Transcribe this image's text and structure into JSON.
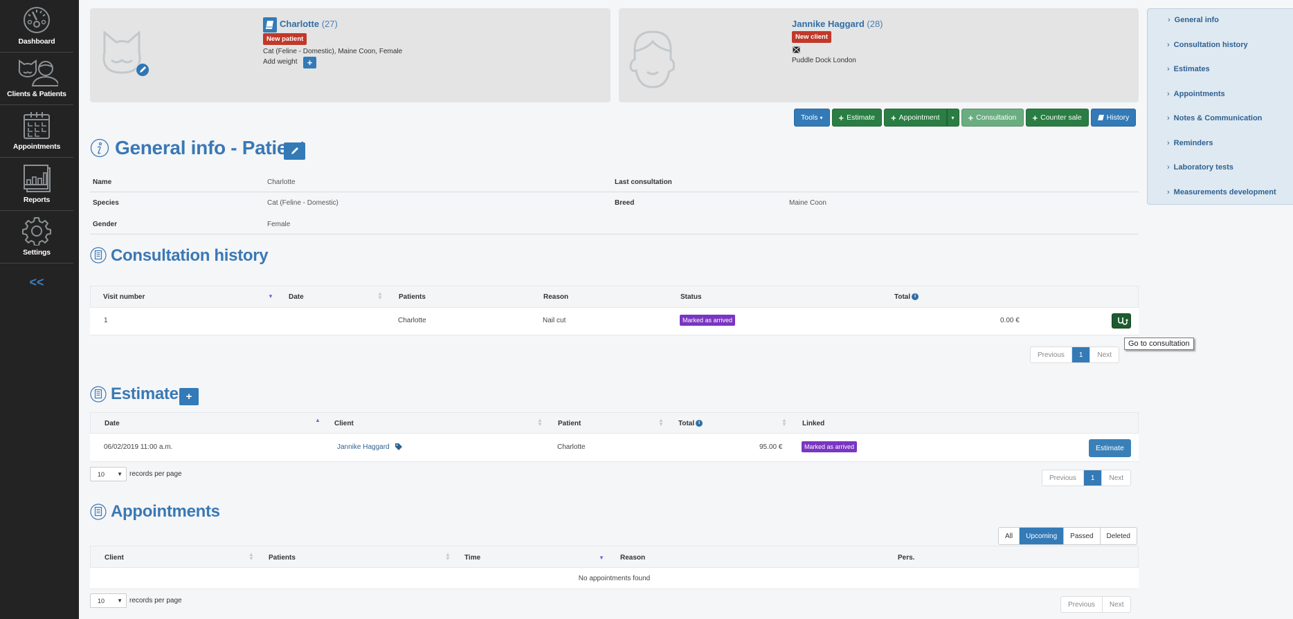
{
  "sidebar": {
    "items": [
      {
        "label": "Dashboard",
        "icon": "dashboard-gauge-icon"
      },
      {
        "label": "Clients & Patients",
        "icon": "clients-patients-icon"
      },
      {
        "label": "Appointments",
        "icon": "calendar-icon"
      },
      {
        "label": "Reports",
        "icon": "bar-chart-icon"
      },
      {
        "label": "Settings",
        "icon": "gear-icon"
      }
    ],
    "collapse_label": "<<"
  },
  "patient_card": {
    "name": "Charlotte",
    "count": "(27)",
    "badge": "New patient",
    "description": "Cat (Feline - Domestic), Maine Coon, Female",
    "add_weight_label": "Add weight",
    "add_weight_button": "+"
  },
  "client_card": {
    "name": "Jannike Haggard",
    "count": "(28)",
    "badge": "New client",
    "address": "Puddle Dock London"
  },
  "actions": {
    "tools": "Tools",
    "estimate": "Estimate",
    "appointment": "Appointment",
    "consultation": "Consultation",
    "counter_sale": "Counter sale",
    "history": "History"
  },
  "right_nav": {
    "items": [
      "General info",
      "Consultation history",
      "Estimates",
      "Appointments",
      "Notes & Communication",
      "Reminders",
      "Laboratory tests",
      "Measurements development"
    ]
  },
  "general_info": {
    "title": "General info - Patient",
    "rows": [
      {
        "label": "Name",
        "value": "Charlotte"
      },
      {
        "label": "Species",
        "value": "Cat (Feline - Domestic)"
      },
      {
        "label": "Gender",
        "value": "Female"
      }
    ],
    "right_rows": [
      {
        "label": "Last consultation",
        "value": ""
      },
      {
        "label": "Breed",
        "value": "Maine Coon"
      }
    ]
  },
  "consultation_history": {
    "title": "Consultation history",
    "columns": [
      "Visit number",
      "Date",
      "Patients",
      "Reason",
      "Status",
      "Total"
    ],
    "rows": [
      {
        "visit_number": "1",
        "date": "",
        "patients": "Charlotte",
        "reason": "Nail cut",
        "status": "Marked as arrived",
        "total": "0.00 €"
      }
    ],
    "pagination": {
      "previous": "Previous",
      "current": "1",
      "next": "Next"
    },
    "tooltip": "Go to consultation"
  },
  "estimates": {
    "title": "Estimates",
    "add_button": "+",
    "columns": [
      "Date",
      "Client",
      "Patient",
      "Total",
      "Linked"
    ],
    "rows": [
      {
        "date": "06/02/2019 11:00 a.m.",
        "client": "Jannike Haggard",
        "patient": "Charlotte",
        "total": "95.00 €",
        "linked": "Marked as arrived",
        "action": "Estimate"
      }
    ],
    "records_per_page": {
      "value": "10",
      "label": "records per page"
    },
    "pagination": {
      "previous": "Previous",
      "current": "1",
      "next": "Next"
    }
  },
  "appointments": {
    "title": "Appointments",
    "filters": [
      "All",
      "Upcoming",
      "Passed",
      "Deleted"
    ],
    "active_filter": "Upcoming",
    "columns": [
      "Client",
      "Patients",
      "Time",
      "Reason",
      "Pers."
    ],
    "empty_message": "No appointments found",
    "records_per_page": {
      "value": "10",
      "label": "records per page"
    },
    "pagination": {
      "previous": "Previous",
      "next": "Next"
    }
  },
  "colors": {
    "primary_blue": "#337ab7",
    "success_green": "#2a7d43",
    "danger_red": "#c0392b",
    "status_purple": "#7a35c1",
    "sidebar_bg": "#232323"
  }
}
